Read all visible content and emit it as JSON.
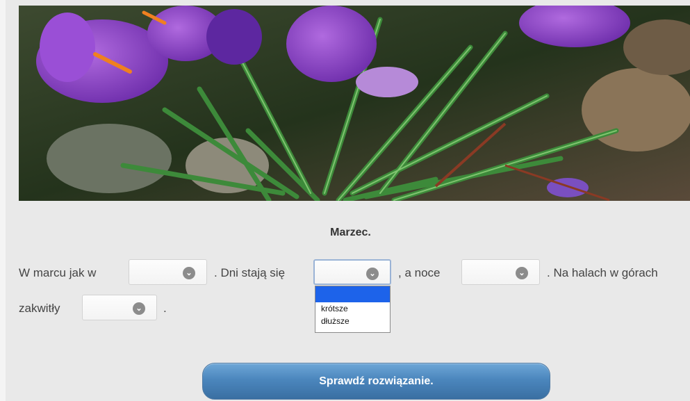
{
  "title": "Marzec.",
  "sentence": {
    "line1": {
      "part1": "W marcu jak w",
      "part2": ". Dni stają się",
      "part3": ", a noce",
      "part4": ". Na halach w górach"
    },
    "line2": {
      "part1": "zakwitły",
      "part2": "."
    }
  },
  "dropdown": {
    "options": [
      "",
      "krótsze",
      "dłuższe"
    ]
  },
  "check_button": "Sprawdź rozwiązanie.",
  "chevron_glyph": "⌄"
}
